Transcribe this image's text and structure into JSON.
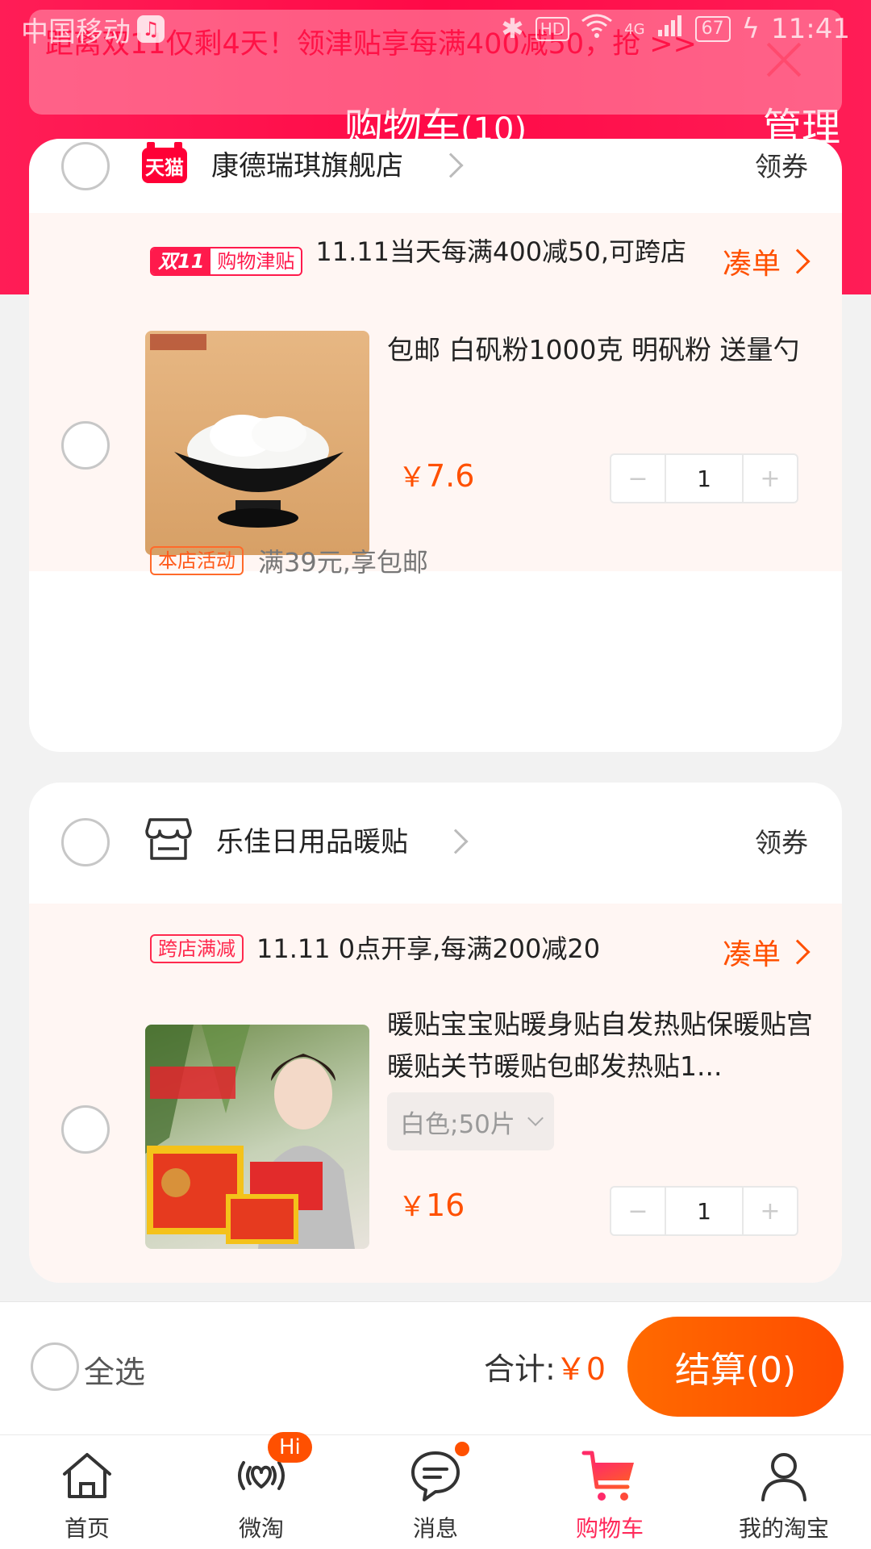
{
  "status_bar": {
    "carrier": "中国移动",
    "net": "4G",
    "hd": "HD",
    "battery": "67",
    "time": "11:41"
  },
  "banner": {
    "text": "距离双11仅剩4天！领津贴享每满400减50，抢 >>"
  },
  "header": {
    "title": "购物车",
    "count": "(10)",
    "manage": "管理"
  },
  "shops": [
    {
      "name": "康德瑞琪旗舰店",
      "badge": "天猫",
      "coupon": "领券",
      "promo": {
        "tag_main": "双11",
        "tag_sub": "购物津贴",
        "text": "11.11当天每满400减50,可跨店",
        "action": "凑单"
      },
      "item": {
        "title": "包邮 白矾粉1000克 明矾粉 送量勺",
        "price_symbol": "￥",
        "price": "7.6",
        "qty": "1",
        "minus": "−",
        "plus": "+"
      },
      "activity": {
        "tag": "本店活动",
        "text": "满39元,享包邮"
      }
    },
    {
      "name": "乐佳日用品暖贴",
      "coupon": "领券",
      "promo": {
        "tag": "跨店满减",
        "text": "11.11 0点开享,每满200减20",
        "action": "凑单"
      },
      "item": {
        "title": "暖贴宝宝贴暖身贴自发热贴保暖贴宫暖贴关节暖贴包邮发热贴1...",
        "sku": "白色;50片",
        "price_symbol": "￥",
        "price": "16",
        "qty": "1",
        "minus": "−",
        "plus": "+"
      }
    }
  ],
  "bottom_bar": {
    "select_all": "全选",
    "total_label": "合计:",
    "total_amount": "￥0",
    "checkout": "结算(0)"
  },
  "tabs": [
    {
      "label": "首页",
      "icon": "home-icon"
    },
    {
      "label": "微淘",
      "icon": "weitao-icon",
      "badge": "Hi"
    },
    {
      "label": "消息",
      "icon": "message-icon"
    },
    {
      "label": "购物车",
      "icon": "cart-icon",
      "active": true
    },
    {
      "label": "我的淘宝",
      "icon": "user-icon"
    }
  ],
  "colors": {
    "brand": "#ff0a47",
    "accent": "#ff5000",
    "promo_bg": "#fff6f3"
  }
}
